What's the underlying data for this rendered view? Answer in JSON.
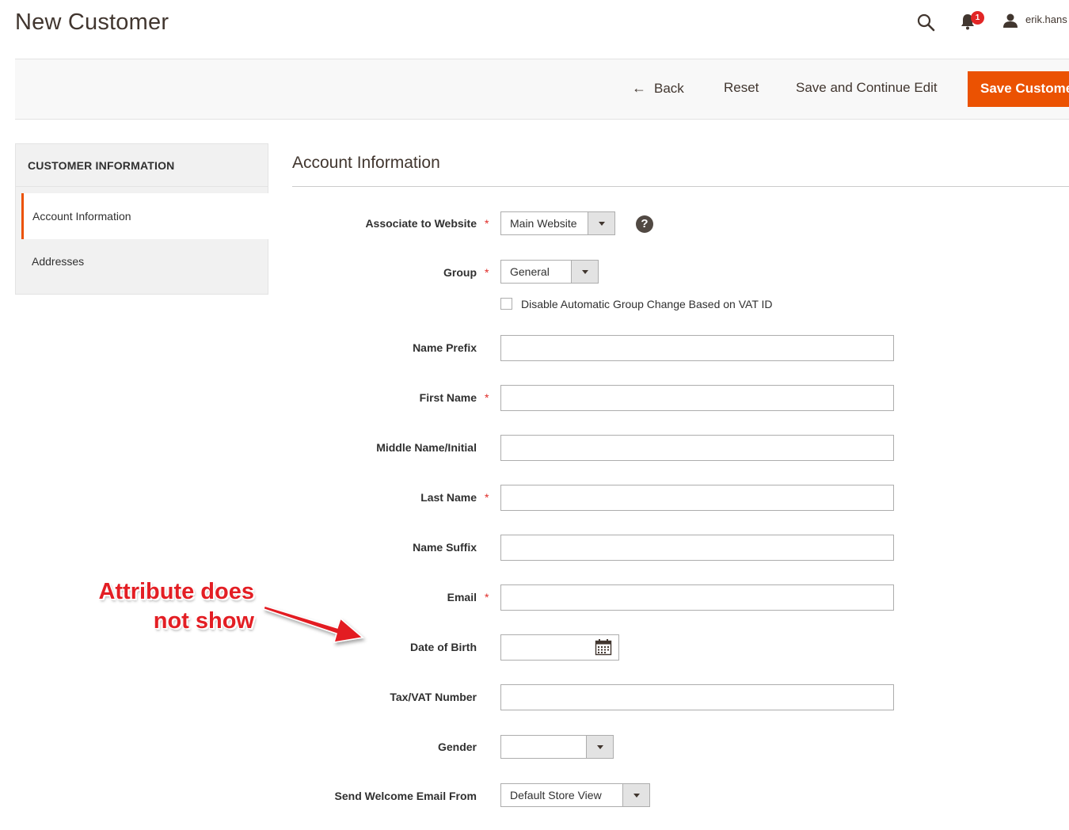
{
  "header": {
    "title": "New Customer",
    "user_name": "erik.hans",
    "notification_count": "1",
    "icons": [
      "search-icon",
      "bell-icon",
      "user-icon"
    ]
  },
  "actions": {
    "back_label": "Back",
    "back_icon": "arrow-left-icon",
    "reset_label": "Reset",
    "save_continue_label": "Save and Continue Edit",
    "save_label": "Save Custome",
    "primary_color": "#eb5202"
  },
  "sidebar": {
    "title": "CUSTOMER INFORMATION",
    "items": [
      {
        "label": "Account Information",
        "active": true
      },
      {
        "label": "Addresses",
        "active": false
      }
    ]
  },
  "section": {
    "title": "Account Information"
  },
  "form": {
    "website": {
      "label": "Associate to Website",
      "value": "Main Website",
      "required": true
    },
    "group": {
      "label": "Group",
      "value": "General",
      "required": true
    },
    "vat_checkbox": {
      "label": "Disable Automatic Group Change Based on VAT ID",
      "checked": false
    },
    "name_prefix": {
      "label": "Name Prefix",
      "value": ""
    },
    "first_name": {
      "label": "First Name",
      "value": "",
      "required": true
    },
    "middle_name": {
      "label": "Middle Name/Initial",
      "value": ""
    },
    "last_name": {
      "label": "Last Name",
      "value": "",
      "required": true
    },
    "name_suffix": {
      "label": "Name Suffix",
      "value": ""
    },
    "email": {
      "label": "Email",
      "value": "",
      "required": true
    },
    "dob": {
      "label": "Date of Birth",
      "value": ""
    },
    "taxvat": {
      "label": "Tax/VAT Number",
      "value": ""
    },
    "gender": {
      "label": "Gender",
      "value": ""
    },
    "welcome_from": {
      "label": "Send Welcome Email From",
      "value": "Default Store View"
    },
    "required_marker": "*"
  },
  "annotation": {
    "line1": "Attribute does",
    "line2": "not show",
    "color": "#e31e24"
  }
}
